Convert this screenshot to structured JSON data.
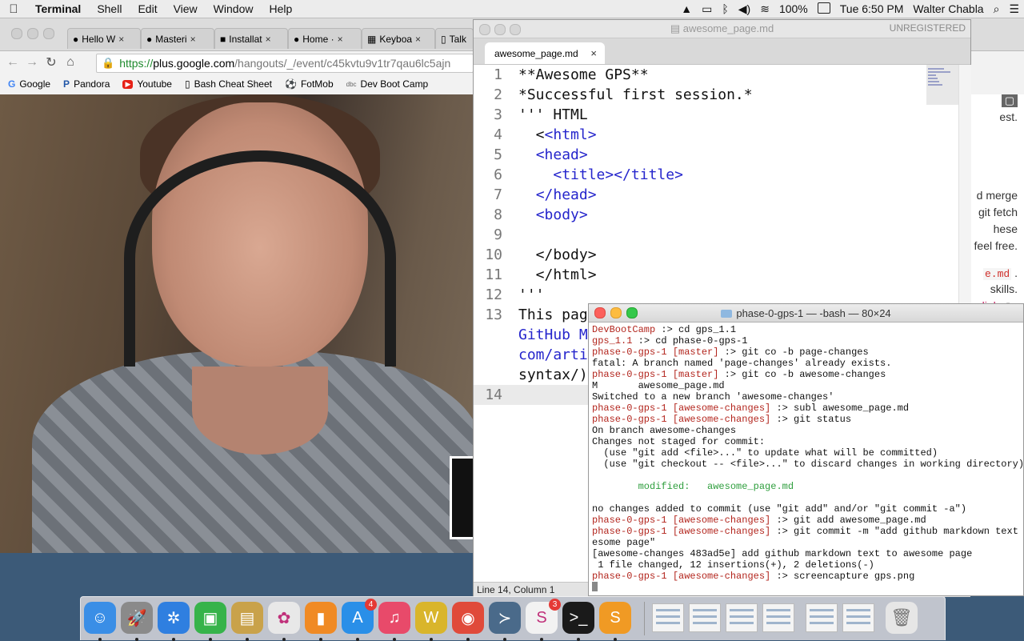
{
  "menubar": {
    "app": "Terminal",
    "items": [
      "Shell",
      "Edit",
      "View",
      "Window",
      "Help"
    ],
    "battery": "100%",
    "clock": "Tue 6:50 PM",
    "user": "Walter Chabla"
  },
  "chrome": {
    "tabs": [
      {
        "label": "Hello W",
        "icon": "github-icon"
      },
      {
        "label": "Masteri",
        "icon": "github-icon"
      },
      {
        "label": "Installat",
        "icon": "page-icon"
      },
      {
        "label": "Home ·",
        "icon": "github-icon"
      },
      {
        "label": "Keyboa",
        "icon": "keyboard-icon"
      },
      {
        "label": "Talk",
        "icon": "page-icon"
      }
    ],
    "url": {
      "scheme": "https://",
      "host": "plus.google.com",
      "path": "/hangouts/_/event/c45kvtu9v1tr7qau6lc5ajn"
    },
    "bookmarks": [
      {
        "label": "Google",
        "icon": "G"
      },
      {
        "label": "Pandora",
        "icon": "P"
      },
      {
        "label": "Youtube",
        "icon": "▶"
      },
      {
        "label": "Bash Cheat Sheet",
        "icon": "▯"
      },
      {
        "label": "FotMob",
        "icon": "⚽"
      },
      {
        "label": "Dev Boot Camp",
        "icon": "dbc"
      }
    ],
    "page_fragments": {
      "line1": "est.",
      "line2": "d merge",
      "line3": "git fetch",
      "line4": "hese",
      "line5": "feel free.",
      "code": "e.md",
      "line6": "skills.",
      "link": "link"
    }
  },
  "sublime": {
    "title": "awesome_page.md",
    "unregistered": "UNREGISTERED",
    "tab_label": "awesome_page.md",
    "status": "Line 14, Column 1",
    "lines": [
      {
        "n": "1",
        "text": "**Awesome GPS**"
      },
      {
        "n": "2",
        "text": "*Successful first session.*"
      },
      {
        "n": "3",
        "text": "''' HTML"
      },
      {
        "n": "4",
        "pre": "  <",
        "tag": "<html>"
      },
      {
        "n": "5",
        "pre": "  ",
        "tag": "<head>"
      },
      {
        "n": "6",
        "pre": "    ",
        "tag": "<title></title>"
      },
      {
        "n": "7",
        "pre": "  ",
        "tag": "</head>"
      },
      {
        "n": "8",
        "pre": "  ",
        "tag": "<body>"
      },
      {
        "n": "9",
        "text": ""
      },
      {
        "n": "10",
        "text": "  </body>"
      },
      {
        "n": "11",
        "text": "  </html>"
      },
      {
        "n": "12",
        "text": "'''"
      },
      {
        "n": "13",
        "text": "This pag",
        "text2": "GitHub M",
        "text3": "com/arti",
        "text4": "syntax/)"
      },
      {
        "n": "14",
        "text": ""
      }
    ]
  },
  "terminal": {
    "title": "phase-0-gps-1 — -bash — 80×24",
    "lines": [
      {
        "prompt": "DevBootCamp",
        "branch": "",
        "cmd": " :> cd gps_1.1"
      },
      {
        "prompt": "gps_1.1",
        "branch": "",
        "cmd": " :> cd phase-0-gps-1"
      },
      {
        "prompt": "phase-0-gps-1",
        "branch": "[master]",
        "cmd": " :> git co -b page-changes"
      },
      {
        "out": "fatal: A branch named 'page-changes' already exists."
      },
      {
        "prompt": "phase-0-gps-1",
        "branch": "[master]",
        "cmd": " :> git co -b awesome-changes"
      },
      {
        "out": "M       awesome_page.md"
      },
      {
        "out": "Switched to a new branch 'awesome-changes'"
      },
      {
        "prompt": "phase-0-gps-1",
        "branch": "[awesome-changes]",
        "cmd": " :> subl awesome_page.md"
      },
      {
        "prompt": "phase-0-gps-1",
        "branch": "[awesome-changes]",
        "cmd": " :> git status"
      },
      {
        "out": "On branch awesome-changes"
      },
      {
        "out": "Changes not staged for commit:"
      },
      {
        "out": "  (use \"git add <file>...\" to update what will be committed)"
      },
      {
        "out": "  (use \"git checkout -- <file>...\" to discard changes in working directory)"
      },
      {
        "out": ""
      },
      {
        "mod": "        modified:   awesome_page.md"
      },
      {
        "out": ""
      },
      {
        "out": "no changes added to commit (use \"git add\" and/or \"git commit -a\")"
      },
      {
        "prompt": "phase-0-gps-1",
        "branch": "[awesome-changes]",
        "cmd": " :> git add awesome_page.md"
      },
      {
        "prompt": "phase-0-gps-1",
        "branch": "[awesome-changes]",
        "cmd": " :> git commit -m \"add github markdown text to aw"
      },
      {
        "out": "esome page\""
      },
      {
        "out": "[awesome-changes 483ad5e] add github markdown text to awesome page"
      },
      {
        "out": " 1 file changed, 12 insertions(+), 2 deletions(-)"
      },
      {
        "prompt": "phase-0-gps-1",
        "branch": "[awesome-changes]",
        "cmd": " :> screencapture gps.png"
      }
    ]
  },
  "dock": {
    "apps": [
      {
        "name": "finder",
        "glyph": "☺",
        "color": "#3a8ee6"
      },
      {
        "name": "launchpad",
        "glyph": "🚀",
        "color": "#8a8a8a"
      },
      {
        "name": "safari",
        "glyph": "✲",
        "color": "#2f7fe0"
      },
      {
        "name": "facetime",
        "glyph": "▣",
        "color": "#36b34a"
      },
      {
        "name": "preview",
        "glyph": "▤",
        "color": "#c9a24a"
      },
      {
        "name": "photos",
        "glyph": "✿",
        "color": "#e8e8e8"
      },
      {
        "name": "ibooks",
        "glyph": "▮",
        "color": "#f08a24"
      },
      {
        "name": "app-store",
        "glyph": "A",
        "color": "#2a8fe8",
        "badge": "4"
      },
      {
        "name": "itunes",
        "glyph": "♫",
        "color": "#e84a6a"
      },
      {
        "name": "wunderlist",
        "glyph": "W",
        "color": "#d9b52b"
      },
      {
        "name": "chrome",
        "glyph": "◉",
        "color": "#e04a3a"
      },
      {
        "name": "xquartz",
        "glyph": "≻",
        "color": "#4a6a8a"
      },
      {
        "name": "slack",
        "glyph": "S",
        "color": "#f2f2f2",
        "badge": "3"
      },
      {
        "name": "terminal",
        "glyph": ">_",
        "color": "#1a1a1a"
      },
      {
        "name": "sublime-text",
        "glyph": "S",
        "color": "#f09a24"
      }
    ]
  }
}
